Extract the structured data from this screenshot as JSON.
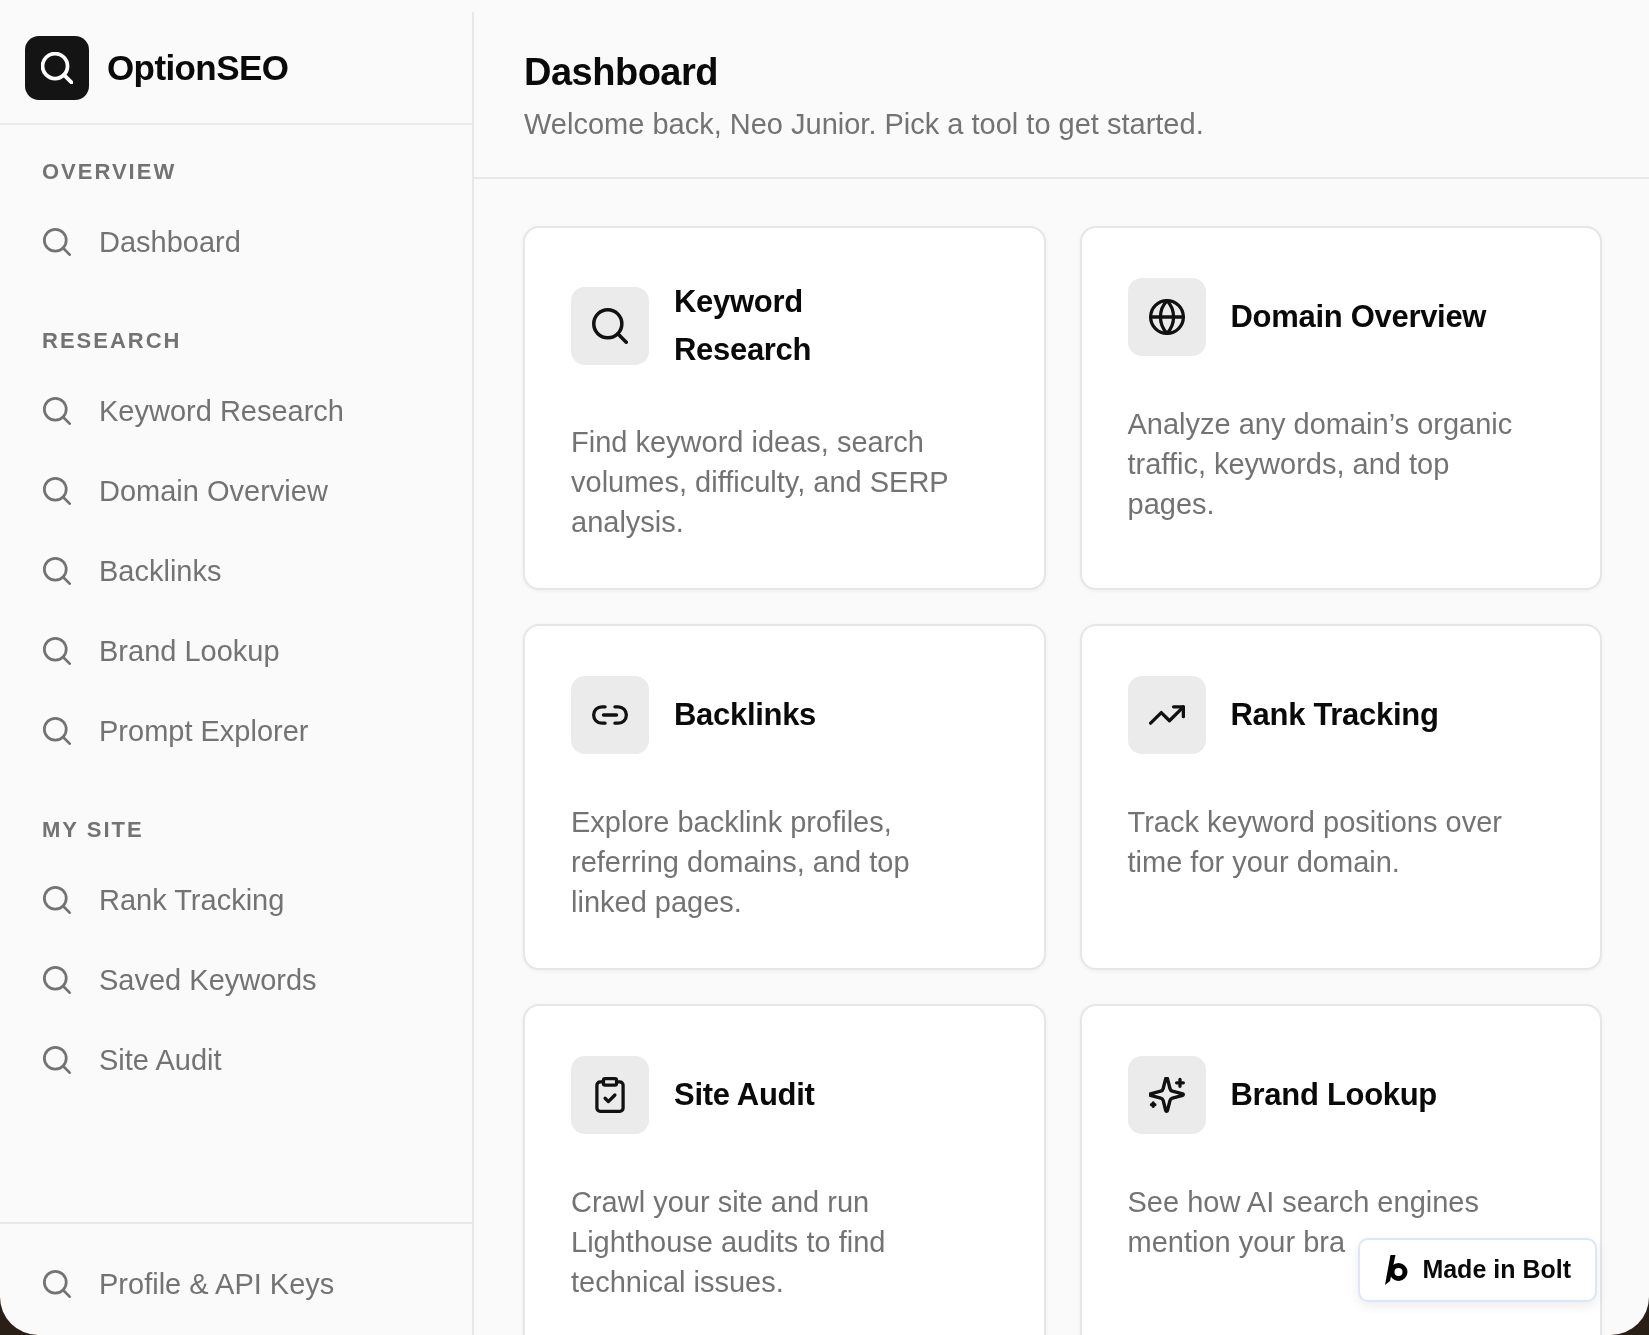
{
  "sidebar": {
    "brand": "OptionSEO",
    "sections": [
      {
        "label": "OVERVIEW",
        "items": [
          {
            "label": "Dashboard",
            "selected": false
          }
        ]
      },
      {
        "label": "RESEARCH",
        "items": [
          {
            "label": "Keyword Research",
            "selected": false
          },
          {
            "label": "Domain Overview",
            "selected": false
          },
          {
            "label": "Backlinks",
            "selected": false
          },
          {
            "label": "Brand Lookup",
            "selected": false
          },
          {
            "label": "Prompt Explorer",
            "selected": false
          }
        ]
      },
      {
        "label": "MY SITE",
        "items": [
          {
            "label": "Rank Tracking",
            "selected": false
          },
          {
            "label": "Saved Keywords",
            "selected": false
          },
          {
            "label": "Site Audit",
            "selected": false
          }
        ]
      }
    ],
    "footer_items": [
      {
        "label": "Profile & API Keys",
        "selected": false
      }
    ]
  },
  "header": {
    "title": "Dashboard",
    "subtitle": "Welcome back, Neo Junior. Pick a tool to get started."
  },
  "tools": [
    {
      "title": "Keyword Research",
      "description": "Find keyword ideas, search volumes, difficulty, and SERP analysis."
    },
    {
      "title": "Domain Overview",
      "description": "Analyze any domain’s organic traffic, keywords, and top pages."
    },
    {
      "title": "Backlinks",
      "description": "Explore backlink profiles, referring domains, and top linked pages."
    },
    {
      "title": "Rank Tracking",
      "description": "Track keyword positions over time for your domain."
    },
    {
      "title": "Site Audit",
      "description": "Crawl your site and run Lighthouse audits to find technical issues."
    },
    {
      "title": "Brand Lookup",
      "description": "See how AI search engines mention your bra"
    }
  ],
  "badge": {
    "label": "Made in Bolt"
  }
}
